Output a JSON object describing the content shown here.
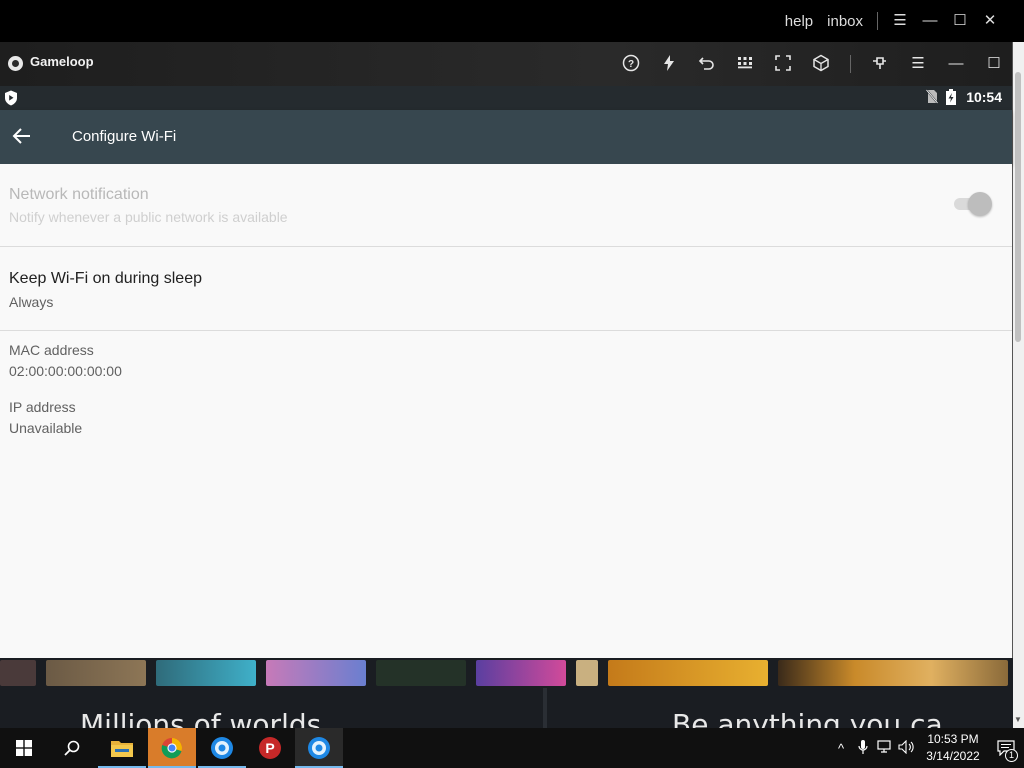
{
  "host_bar": {
    "help_label": "help",
    "inbox_label": "inbox"
  },
  "emulator": {
    "name": "Gameloop"
  },
  "status_bar": {
    "time": "10:54"
  },
  "app_bar": {
    "title": "Configure Wi-Fi"
  },
  "settings": {
    "network_notification": {
      "title": "Network notification",
      "summary": "Notify whenever a public network is available",
      "enabled": false,
      "toggle_on": false
    },
    "keep_wifi": {
      "title": "Keep Wi-Fi on during sleep",
      "summary": "Always"
    },
    "mac": {
      "title": "MAC address",
      "value": "02:00:00:00:00:00"
    },
    "ip": {
      "title": "IP address",
      "value": "Unavailable"
    }
  },
  "website": {
    "headline_left": "Millions of worlds",
    "headline_right": "Be anything you ca"
  },
  "taskbar": {
    "clock_time": "10:53 PM",
    "clock_date": "3/14/2022",
    "notification_count": "1"
  },
  "colors": {
    "app_bar": "#37474f",
    "status_bar": "#252b2f",
    "content_bg": "#f9f9f9",
    "taskbar": "#101010"
  }
}
